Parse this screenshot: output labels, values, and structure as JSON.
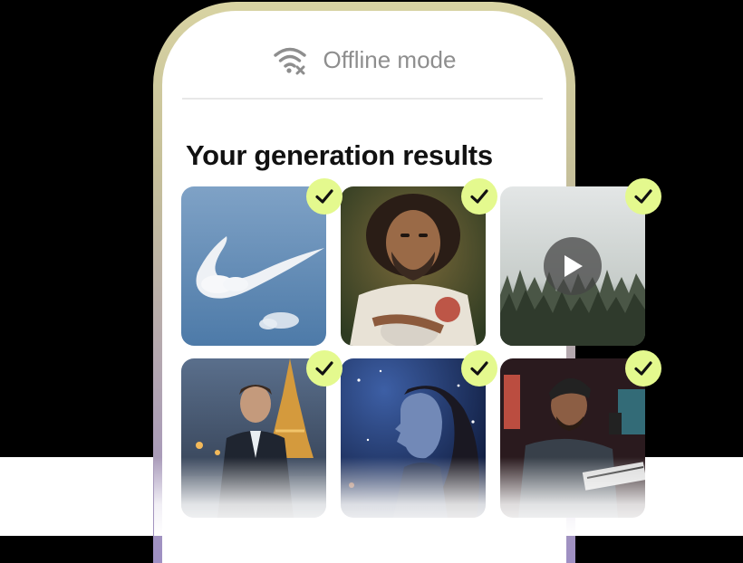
{
  "status_bar": {
    "label": "Offline mode",
    "icon": "wifi-off-icon",
    "color": "#8e8e8e"
  },
  "results": {
    "title": "Your generation results",
    "check_color": "#e4f98e",
    "items": [
      {
        "kind": "image",
        "subject": "cloud-swoosh-image",
        "checked": true
      },
      {
        "kind": "image",
        "subject": "rugby-player-image",
        "checked": true
      },
      {
        "kind": "video",
        "subject": "foggy-forest-video",
        "checked": true
      },
      {
        "kind": "image",
        "subject": "man-at-eiffel-tower-image",
        "checked": true
      },
      {
        "kind": "image",
        "subject": "woman-starry-sky-image",
        "checked": true
      },
      {
        "kind": "image",
        "subject": "music-producer-studio-image",
        "checked": true
      }
    ]
  }
}
